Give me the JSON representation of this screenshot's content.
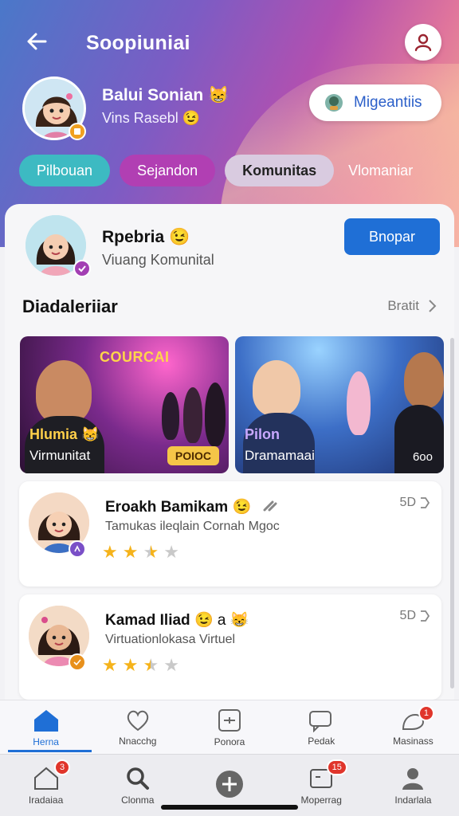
{
  "header": {
    "title": "Soopiuniai",
    "back_icon": "arrow-left-icon",
    "profile_icon": "user-icon"
  },
  "user": {
    "name": "Balui Sonian",
    "name_emoji": "😸",
    "subtitle": "Vins Rasebl",
    "subtitle_emoji": "😉",
    "action_label": "Migeantiis"
  },
  "chips": [
    {
      "label": "Pilbouan"
    },
    {
      "label": "Sejandon"
    },
    {
      "label": "Komunitas"
    },
    {
      "label": "Vlomaniar"
    }
  ],
  "community": {
    "name": "Rpebria",
    "name_emoji": "😉",
    "subtitle": "Viuang Komunital",
    "button_label": "Bnopar"
  },
  "section": {
    "title": "Diadaleriiar",
    "link_label": "Bratit"
  },
  "featured": [
    {
      "banner": "COURCAI",
      "title": "Hlumia 😸",
      "subtitle": "Virmunitat",
      "tag": "POIOC"
    },
    {
      "title": "Pilon",
      "subtitle": "Dramamaai",
      "count": "6oo"
    }
  ],
  "list": [
    {
      "name": "Eroakh Bamikam",
      "name_emoji": "😉",
      "subtitle": "Tamukas ileqlain Cornah Mgoc",
      "right": "5D",
      "rating": 2.5,
      "badge_color": "#7a4fc7"
    },
    {
      "name": "Kamad Iliad",
      "name_emoji": "😉",
      "extra": "a",
      "subtitle": "Virtuationlokasa Virtuel",
      "right": "5D",
      "rating": 2.5,
      "badge_color": "#e8901c"
    }
  ],
  "nav_primary": [
    {
      "label": "Herna",
      "icon": "home-icon",
      "active": true
    },
    {
      "label": "Nnacchg",
      "icon": "heart-icon"
    },
    {
      "label": "Ponora",
      "icon": "calendar-icon"
    },
    {
      "label": "Pedak",
      "icon": "message-icon"
    },
    {
      "label": "Masinass",
      "icon": "chat-icon",
      "badge": "1"
    }
  ],
  "nav_secondary": [
    {
      "label": "Iradaiaa",
      "icon": "home-outline-icon",
      "badge": "3"
    },
    {
      "label": "Clonma",
      "icon": "search-icon"
    },
    {
      "label": "",
      "icon": "plus-icon"
    },
    {
      "label": "Moperrag",
      "icon": "document-icon",
      "badge": "15"
    },
    {
      "label": "Indarlala",
      "icon": "profile-icon"
    }
  ],
  "colors": {
    "accent": "#1f6fd6",
    "chip_teal": "#3dbac2",
    "chip_purple": "#b13fb3",
    "star": "#f5b31b"
  }
}
